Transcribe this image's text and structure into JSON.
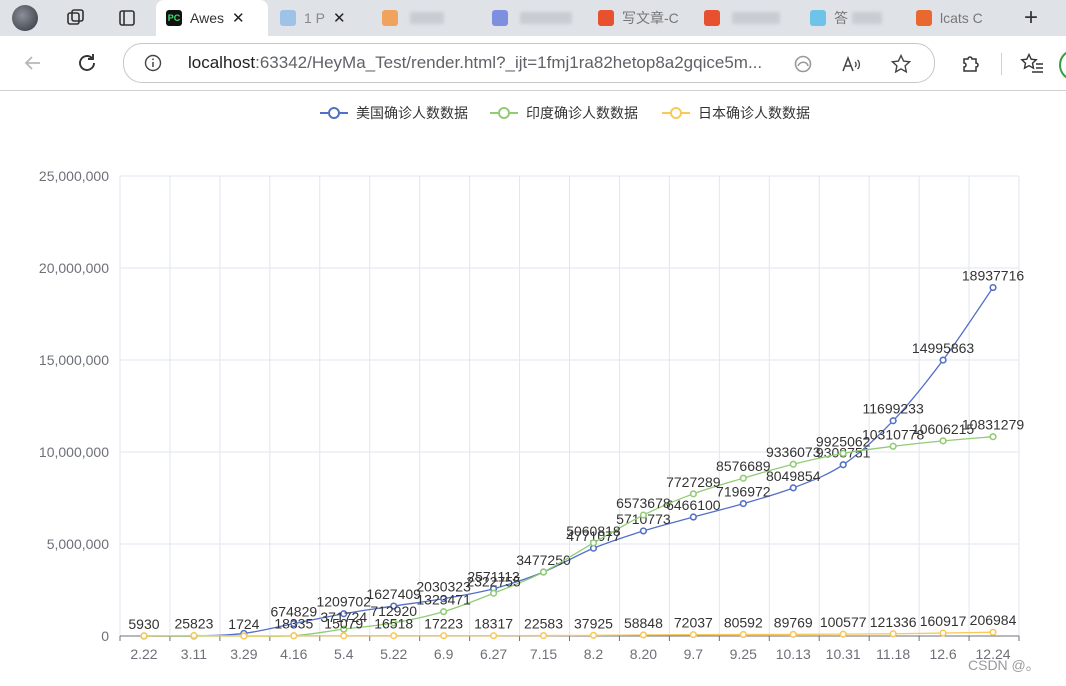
{
  "browser": {
    "active_tab_title": "Awes",
    "url_host": "localhost",
    "url_path": ":63342/HeyMa_Test/render.html?_ijt=1fmj1ra82hetop8a2gqice5m...",
    "tab_fragments": [
      "1 P",
      "ﾞ",
      "写文章-C",
      "答",
      "lcats C"
    ],
    "accent": "#1a73e8"
  },
  "chart_data": {
    "type": "line",
    "legend": [
      "美国确诊人数数据",
      "印度确诊人数数据",
      "日本确诊人数数据"
    ],
    "categories": [
      "2.22",
      "3.11",
      "3.29",
      "4.16",
      "5.4",
      "5.22",
      "6.9",
      "6.27",
      "7.15",
      "8.2",
      "8.20",
      "9.7",
      "9.25",
      "10.13",
      "10.31",
      "11.18",
      "12.6",
      "12.24"
    ],
    "x_tick_labels": [
      "2.22",
      "3.11",
      "3.29",
      "4.16",
      "5.4",
      "5.22",
      "6.9",
      "6.27",
      "7.15",
      "8.2",
      "8.20",
      "9.7",
      "9.25",
      "10.13",
      "10.31",
      "11.18",
      "12.6",
      "12.24"
    ],
    "ylim": [
      0,
      25000000
    ],
    "y_tick_labels": [
      "0",
      "5,000,000",
      "10,000,000",
      "15,000,000",
      "20,000,000",
      "25,000,000"
    ],
    "y_ticks": [
      0,
      5000000,
      10000000,
      15000000,
      20000000,
      25000000
    ],
    "series": [
      {
        "name": "美国确诊人数数据",
        "color": "#5470c6",
        "values": [
          35,
          1700,
          140000,
          674829,
          1209702,
          1627409,
          2030323,
          2571113,
          3477250,
          4771077,
          5710773,
          6466100,
          7196972,
          8049854,
          9308751,
          11699233,
          14995863,
          18937716
        ],
        "labels": [
          "",
          "",
          "",
          "674829",
          "1209702",
          "1627409",
          "2030323",
          "2571113",
          "3477250",
          "4771077",
          "5710773",
          "6466100",
          "7196972",
          "8049854",
          "9308751",
          "11699233",
          "14995863",
          "18937716"
        ]
      },
      {
        "name": "印度确诊人数数据",
        "color": "#91cc75",
        "values": [
          3,
          40,
          1100,
          13835,
          371724,
          712920,
          1323471,
          2322755,
          3477250,
          5060818,
          6573678,
          7727289,
          8576689,
          9336073,
          9925062,
          10310778,
          10606215,
          10831279
        ],
        "labels": [
          "",
          "",
          "",
          "18335",
          "371724",
          "712920",
          "1323471",
          "2322755",
          "",
          "5060818",
          "6573678",
          "7727289",
          "8576689",
          "9336073",
          "9925062",
          "10310778",
          "10606215",
          "10831279"
        ]
      },
      {
        "name": "日本确诊人数数据",
        "color": "#fac858",
        "values": [
          5930,
          25823,
          1724,
          15079,
          15079,
          16518,
          17223,
          18317,
          22583,
          37925,
          58848,
          72037,
          80592,
          89769,
          100577,
          121336,
          160917,
          206984
        ],
        "labels": [
          "5930",
          "25823",
          "1724",
          "",
          "15079",
          "16518",
          "17223",
          "18317",
          "22583",
          "37925",
          "58848",
          "72037",
          "80592",
          "89769",
          "100577",
          "121336",
          "160917",
          "206984"
        ]
      }
    ]
  },
  "watermark": "CSDN @。"
}
